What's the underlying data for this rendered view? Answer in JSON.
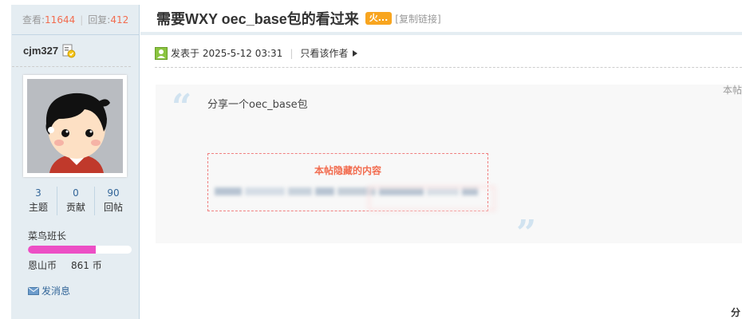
{
  "stats": {
    "views_label": "查看:",
    "views": "11644",
    "replies_label": "回复:",
    "replies": "412"
  },
  "user": {
    "name": "cjm327",
    "counts": [
      {
        "value": "3",
        "label": "主题"
      },
      {
        "value": "0",
        "label": "贡献"
      },
      {
        "value": "90",
        "label": "回帖"
      }
    ],
    "rank": "菜鸟班长",
    "rank_progress": 0.65,
    "coin_label": "恩山币",
    "coin_value": "861 币",
    "pm_label": "发消息"
  },
  "thread": {
    "title": "需要WXY oec_base包的看过来",
    "hot_badge": "火...",
    "copy_link": "[复制链接]"
  },
  "post": {
    "posted_at": "发表于 2025-5-12 03:31",
    "only_author": "只看该作者",
    "side_note": "本帖",
    "text": "分享一个oec_base包",
    "hidden_title": "本帖隐藏的内容",
    "corner_text": "分"
  },
  "colors": {
    "accent": "#f26c4f",
    "link": "#336699",
    "rank_fill": "#ec4fc5",
    "sidebar_bg": "#e5edf2"
  }
}
